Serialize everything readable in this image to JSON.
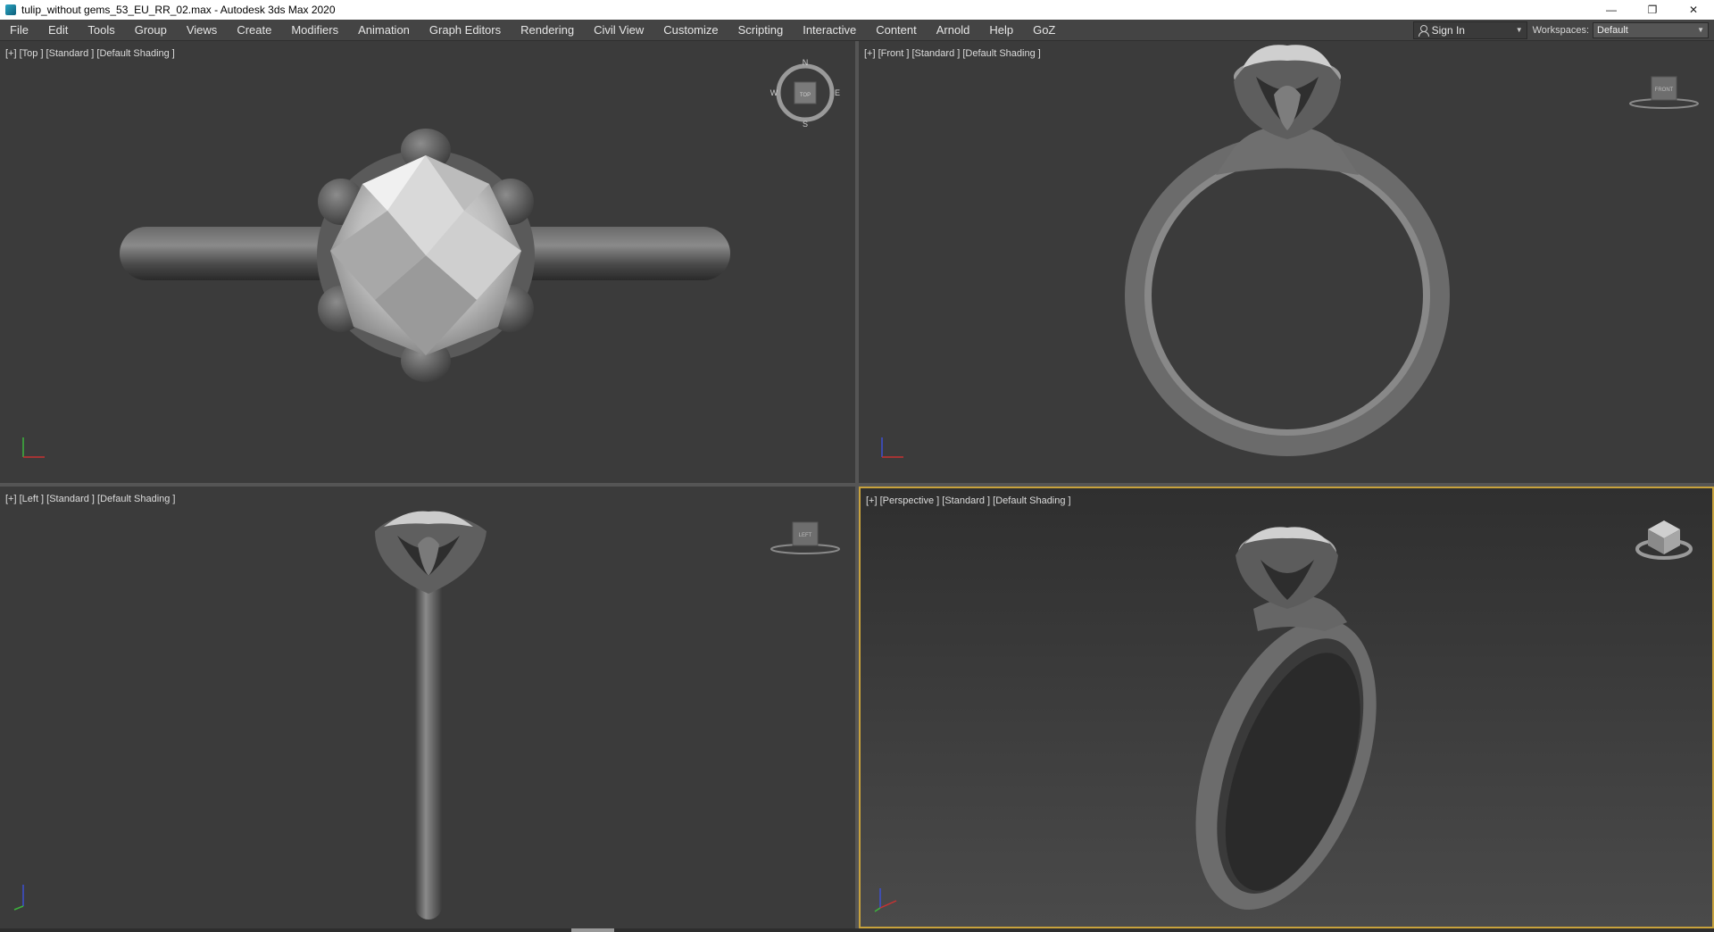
{
  "window": {
    "title": "tulip_without gems_53_EU_RR_02.max - Autodesk 3ds Max 2020",
    "minimize": "—",
    "restore": "❐",
    "close": "✕"
  },
  "menu": [
    "File",
    "Edit",
    "Tools",
    "Group",
    "Views",
    "Create",
    "Modifiers",
    "Animation",
    "Graph Editors",
    "Rendering",
    "Civil View",
    "Customize",
    "Scripting",
    "Interactive",
    "Content",
    "Arnold",
    "Help",
    "GoZ"
  ],
  "account": {
    "sign_in": "Sign In"
  },
  "workspace": {
    "label": "Workspaces:",
    "value": "Default"
  },
  "viewports": {
    "top": {
      "label": "[+] [Top ] [Standard ] [Default Shading ]",
      "cube": "TOP",
      "compass": {
        "n": "N",
        "s": "S",
        "e": "E",
        "w": "W"
      }
    },
    "front": {
      "label": "[+] [Front ] [Standard ] [Default Shading ]",
      "cube": "FRONT"
    },
    "left": {
      "label": "[+] [Left ] [Standard ] [Default Shading ]",
      "cube": "LEFT"
    },
    "perspective": {
      "label": "[+] [Perspective ] [Standard ] [Default Shading ]",
      "active": true
    }
  },
  "colors": {
    "viewport_bg": "#3b3b3b",
    "active_border": "#c8a23c",
    "menu_bg": "#444444",
    "axis_x": "#c83232",
    "axis_y": "#3cb43c",
    "axis_z": "#3c50d2"
  }
}
